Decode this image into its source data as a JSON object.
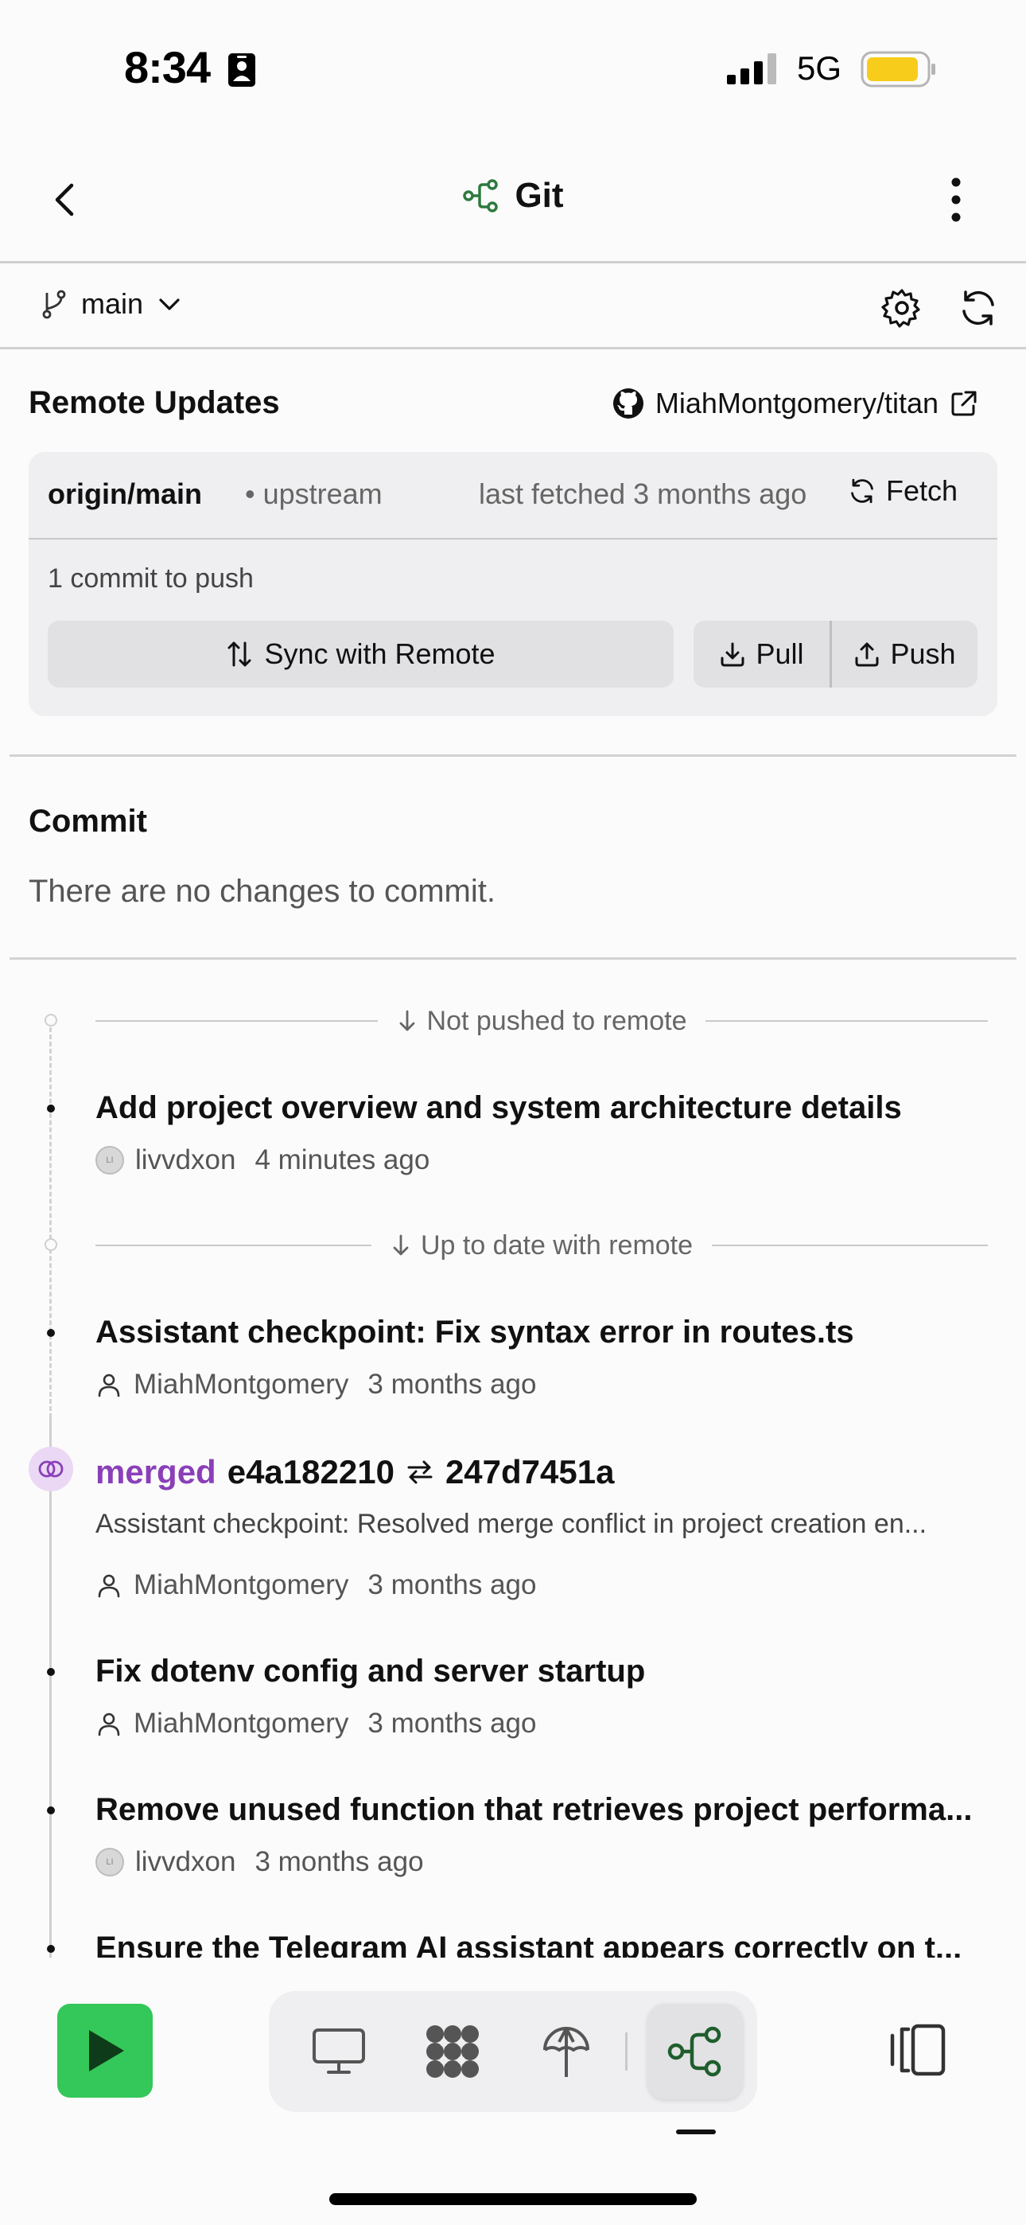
{
  "status_bar": {
    "time": "8:34",
    "network": "5G",
    "battery_color": "#f7cc1b"
  },
  "header": {
    "title": "Git",
    "icon": "git-branch-icon",
    "accent": "#2d7a3f"
  },
  "branch_bar": {
    "branch": "main"
  },
  "remote_updates": {
    "title": "Remote Updates",
    "repo": "MiahMontgomery/titan",
    "upstream_name": "origin/main",
    "upstream_tag": "• upstream",
    "last_fetched": "last fetched 3 months ago",
    "fetch_label": "Fetch",
    "commit_count": "1 commit to push",
    "sync_label": "Sync with Remote",
    "pull_label": "Pull",
    "push_label": "Push"
  },
  "commit": {
    "title": "Commit",
    "empty_message": "There are no changes to commit."
  },
  "timeline": {
    "not_pushed_label": "Not pushed to remote",
    "up_to_date_label": "Up to date with remote",
    "entries": [
      {
        "title": "Add project overview and system architecture details",
        "author": "livvdxon",
        "time": "4 minutes ago",
        "avatar": "LI"
      },
      {
        "title": "Assistant checkpoint: Fix syntax error in routes.ts",
        "author": "MiahMontgomery",
        "time": "3 months ago"
      },
      {
        "title": "Fix dotenv config and server startup",
        "author": "MiahMontgomery",
        "time": "3 months ago"
      },
      {
        "title": "Remove unused function that retrieves project performa...",
        "author": "livvdxon",
        "time": "3 months ago",
        "avatar": "LI"
      },
      {
        "title": "Ensure the Telegram AI assistant appears correctly on t..."
      }
    ],
    "merge": {
      "badge": "merged",
      "from_hash": "e4a182210",
      "to_hash": "247d7451a",
      "description": "Assistant checkpoint: Resolved merge conflict in project creation en...",
      "author": "MiahMontgomery",
      "time": "3 months ago",
      "color": "#8a3fb8"
    }
  },
  "tabbar": {
    "run_color": "#34c759",
    "tabs": [
      "desktop-icon",
      "packages-icon",
      "deploy-icon",
      "git-icon"
    ],
    "active": "git-icon"
  }
}
